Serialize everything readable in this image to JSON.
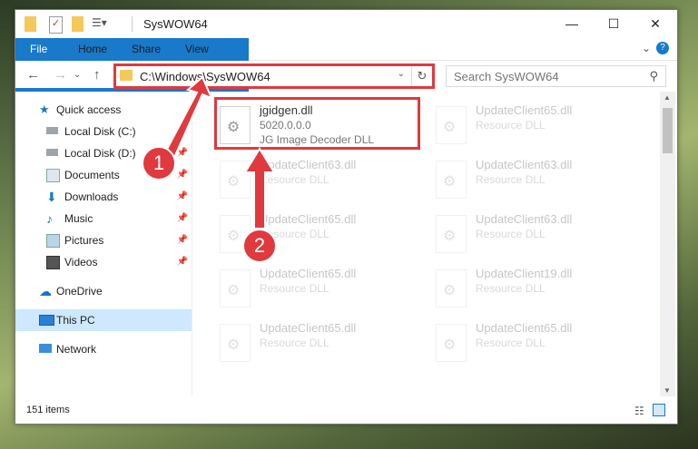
{
  "window": {
    "title": "SysWOW64",
    "minimize": "—",
    "maximize": "☐",
    "close": "✕"
  },
  "ribbon": {
    "tabs": [
      "File",
      "Home",
      "Share",
      "View"
    ],
    "expand": "⌄",
    "help": "?"
  },
  "nav": {
    "back": "←",
    "forward": "→",
    "history": "⌄",
    "up": "↑"
  },
  "address": {
    "path": "C:\\Windows\\SysWOW64",
    "dropdown": "⌄",
    "refresh": "↻"
  },
  "search": {
    "placeholder": "Search SysWOW64",
    "icon": "search-icon"
  },
  "sidebar": {
    "items": [
      {
        "label": "Quick access",
        "icon": "star-icon",
        "pinned": false
      },
      {
        "label": "Local Disk (C:)",
        "icon": "drive-icon",
        "pinned": true
      },
      {
        "label": "Local Disk (D:)",
        "icon": "drive-icon",
        "pinned": true
      },
      {
        "label": "Documents",
        "icon": "documents-icon",
        "pinned": true
      },
      {
        "label": "Downloads",
        "icon": "download-icon",
        "pinned": true
      },
      {
        "label": "Music",
        "icon": "music-icon",
        "pinned": true
      },
      {
        "label": "Pictures",
        "icon": "pictures-icon",
        "pinned": true
      },
      {
        "label": "Videos",
        "icon": "videos-icon",
        "pinned": true
      },
      {
        "label": "OneDrive",
        "icon": "cloud-icon",
        "pinned": false
      },
      {
        "label": "This PC",
        "icon": "computer-icon",
        "pinned": false,
        "selected": true
      },
      {
        "label": "Network",
        "icon": "network-icon",
        "pinned": false
      }
    ],
    "pin_glyph": "📌"
  },
  "files": [
    {
      "name": "jgidgen.dll",
      "version": "5020.0.0.0",
      "desc": "JG Image Decoder DLL"
    },
    {
      "name": "UpdateClient65.dll",
      "desc": "Resource DLL"
    },
    {
      "name": "UpdateClient63.dll",
      "desc": "Resource DLL"
    },
    {
      "name": "UpdateClient63.dll",
      "desc": "Resource DLL"
    },
    {
      "name": "UpdateClient65.dll",
      "desc": "Resource DLL"
    },
    {
      "name": "UpdateClient63.dll",
      "desc": "Resource DLL"
    },
    {
      "name": "UpdateClient65.dll",
      "desc": "Resource DLL"
    },
    {
      "name": "UpdateClient19.dll",
      "desc": "Resource DLL"
    },
    {
      "name": "UpdateClient65.dll",
      "desc": "Resource DLL"
    },
    {
      "name": "UpdateClient65.dll",
      "desc": "Resource DLL"
    }
  ],
  "status": {
    "count": "151 items"
  },
  "annotations": {
    "step1": "1",
    "step2": "2",
    "color": "#e0393e"
  }
}
